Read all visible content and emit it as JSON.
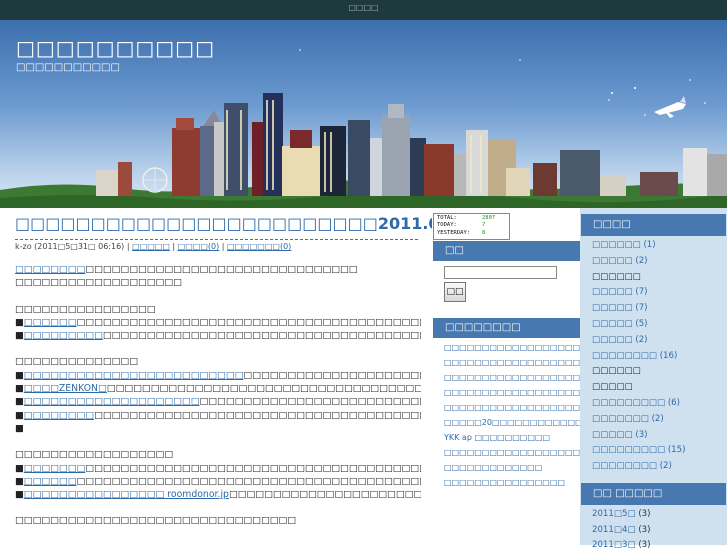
{
  "topbar": {
    "text": "□□□□"
  },
  "header": {
    "title": "□□□□□□□□□□",
    "description": "□□□□□□□□□□□"
  },
  "post": {
    "title": "□□□□□□□□□□□□□□□□□□□□□□□□2011.06.02□□",
    "meta_author_date": "k-zo (2011□5□31□ 06:16) |",
    "meta_category": "□□□□□",
    "meta_comments": "□□□□(0)",
    "meta_trackbacks": "□□□□□□□(0)",
    "lines": [
      {
        "link": "□□□□□□□□",
        "text": "□□□□□□□□□□□□□□□□□□□□□□□□□□□□□□□"
      },
      {
        "text": "□□□□□□□□□□□□□□□□□□□"
      },
      {
        "text": ""
      },
      {
        "text": "□□□□□□□□□□□□□□□□"
      },
      {
        "bullet": "■",
        "link": "□□□□□□",
        "text": "□□□□□□□□□□□□□□□□□□□□□□□□□□□□□□□□□□□□□□□□□□□□□□"
      },
      {
        "bullet": "■",
        "link": "□□□□□□□□□",
        "text": "□□□□□□□□□□□□□□□□□□□□□□□□□□□□□□□□□□□□□□□□"
      },
      {
        "text": ""
      },
      {
        "text": "□□□□□□□□□□□□□□"
      },
      {
        "bullet": "■",
        "link": "□□□□□□□□□□□□□□□□□□□□□□□□□",
        "text": "□□□□□□□□□□□□□□□□□□□□□□□□□□□□□□□□□□□□□□□□□□□□□□□□□□□□□□□□□□□□□□□□□□□□□□□□□□□□□□□",
        "wrap": true
      },
      {
        "bullet": "■",
        "link": "□□□□ZENKON□",
        "text": "□□□□□□□□□□□□□□□□□□□□□□□□□□□□□□□□□□□□□□□□□□□□□□□□□□□□□□□□□□□□□□□□□□□□□□□□□□",
        "wrap": true
      },
      {
        "bullet": "■",
        "link": "□□□□□□□□□□□□□□□□□□□□",
        "text": "□□□□□□□□□□□□□□□□□□□□□□□□□□□□□□□□□□□□□□□□□□□□□□□□"
      },
      {
        "bullet": "■",
        "link": "□□□□□□□□",
        "text": "□□□□□□□□□□□□□□□□□□□□□□□□□□□□□□□□□□□□□□□□□□□□□□□□□□□□□□□□□"
      },
      {
        "text": "■"
      },
      {
        "text": ""
      },
      {
        "text": "□□□□□□□□□□□□□□□□□□"
      },
      {
        "bullet": "■",
        "link": "□□□□□□□",
        "text": "□□□□□□□□□□□□□□□□□□□□□□□□□□□□□□□□□□□□□□□□□□□□□□"
      },
      {
        "bullet": "■",
        "link": "□□□□□□",
        "text": "□□□□□□□□□□□□□□□□□□□□□□□□□□□□□□□□□□□□□□□□□"
      },
      {
        "bullet": "■",
        "link": "□□□□□□□□□□□□□□□□ roomdonor.jp",
        "text": "□□□□□□□□□□□□□□□□□□□□□□□□□□□□□□□□□□□□□□"
      },
      {
        "text": ""
      },
      {
        "text": "□□□□□□□□□□□□□□□□□□□□□□□□□□□□□□□□"
      }
    ]
  },
  "counter": {
    "total_label": "TOTAL:",
    "total_value": "2807",
    "today_label": "TODAY:",
    "today_value": "7",
    "yesterday_label": "YESTERDAY:",
    "yesterday_value": "8"
  },
  "search": {
    "heading": "□□",
    "button": "□□",
    "value": ""
  },
  "recent": {
    "heading": "□□□□□□□□",
    "items": [
      "□□□□□□□□□□□□□□□□□□□□□□□□2011.06.02□□",
      "□□□□□□□□□□□□□□□□□□□□2011.06.02□□",
      "□□□□□□□□□□□□□□□□□□",
      "□□□□□□□□□□□□□□□□□□□□□□□□2011.04.22□□",
      "□□□□□□□□□□□□□□□□□□□□□□□□□2011.05.26□□",
      "□□□□□20□□□□□□□□□□□□□□",
      "YKK ap □□□□□□□□□□",
      "□□□□□□□□□□□□□□□□□□□□□□",
      "□□□□□□□□□□□□□",
      "□□□□□□□□□□□□□□□□"
    ]
  },
  "categories": {
    "heading": "□□□□",
    "items": [
      {
        "label": "□□□□□□",
        "count": "(1)",
        "linked": true
      },
      {
        "label": "□□□□□",
        "count": "(2)",
        "linked": true
      },
      {
        "label": "□□□□□□",
        "count": "",
        "linked": false
      },
      {
        "label": "□□□□□",
        "count": "(7)",
        "linked": true
      },
      {
        "label": "□□□□□",
        "count": "(7)",
        "linked": true
      },
      {
        "label": "□□□□□",
        "count": "(5)",
        "linked": true
      },
      {
        "label": "□□□□□",
        "count": "(2)",
        "linked": true
      },
      {
        "label": "□□□□□□□□",
        "count": "(16)",
        "linked": true
      },
      {
        "label": "□□□□□□",
        "count": "",
        "linked": false
      },
      {
        "label": "□□□□□",
        "count": "",
        "linked": false
      },
      {
        "label": "□□□□□□□□□",
        "count": "(6)",
        "linked": true
      },
      {
        "label": "□□□□□□□",
        "count": "(2)",
        "linked": true
      },
      {
        "label": "□□□□□",
        "count": "(3)",
        "linked": true
      },
      {
        "label": "□□□□□□□□□",
        "count": "(15)",
        "linked": true
      },
      {
        "label": "□□□□□□□□",
        "count": "(2)",
        "linked": true
      }
    ]
  },
  "archives": {
    "heading": "□□ □□□□□",
    "items": [
      {
        "label": "2011□5□",
        "count": "(3)"
      },
      {
        "label": "2011□4□",
        "count": "(3)"
      },
      {
        "label": "2011□3□",
        "count": "(3)"
      }
    ]
  },
  "colors": {
    "link": "#2e69a8",
    "sidebar_head": "#4878b0",
    "sidebar_bg": "#cfe1ef"
  }
}
